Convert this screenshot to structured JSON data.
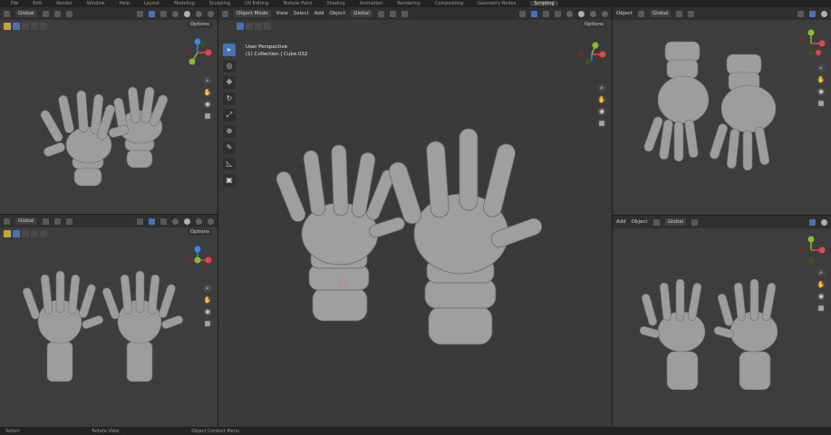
{
  "topbar": {
    "items": [
      "File",
      "Edit",
      "Render",
      "Window",
      "Help",
      "Layout",
      "Modeling",
      "Sculpting",
      "UV Editing",
      "Texture Paint",
      "Shading",
      "Animation",
      "Rendering",
      "Compositing",
      "Geometry Nodes",
      "Scripting"
    ],
    "active": "Layout"
  },
  "main_viewport": {
    "mode": "Object Mode",
    "menus": [
      "View",
      "Select",
      "Add",
      "Object"
    ],
    "transform": "Global",
    "options": "Options",
    "info_line1": "User Perspective",
    "info_line2": "(1) Collection | Cube.032"
  },
  "viewport_tl": {
    "transform": "Global",
    "options": "Options"
  },
  "viewport_bl": {
    "transform": "Global",
    "options": "Options"
  },
  "viewport_tr": {
    "menu": "Object",
    "transform": "Global"
  },
  "viewport_br": {
    "menus": [
      "Add",
      "Object"
    ],
    "transform": "Global"
  },
  "statusbar": {
    "items": [
      "Select",
      "Rotate View",
      "Object Context Menu"
    ]
  },
  "colors": {
    "accent": "#4772b3",
    "axis_x": "#e0474c",
    "axis_y": "#8bbb2a",
    "axis_z": "#3d85e6",
    "model": "#9d9d9d"
  },
  "icons": {
    "nav": [
      "zoom-icon",
      "hand-icon",
      "camera-icon",
      "grid-icon"
    ],
    "tools": [
      "select-box-icon",
      "cursor-icon",
      "move-icon",
      "rotate-icon",
      "scale-icon",
      "transform-icon",
      "annotate-icon",
      "measure-icon",
      "add-cube-icon"
    ]
  }
}
